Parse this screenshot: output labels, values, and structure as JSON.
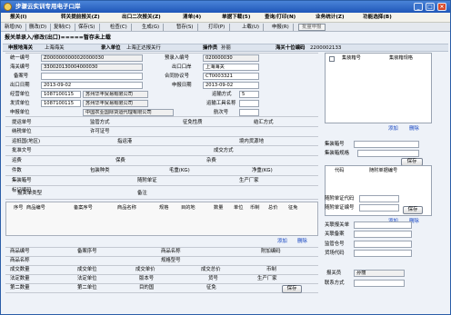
{
  "window": {
    "title": "步骤云实训专用电子口岸",
    "min": "_",
    "max": "□",
    "close": "×"
  },
  "menu": [
    {
      "id": "baoguan",
      "label": "报关(I)"
    },
    {
      "id": "zhuanguan",
      "label": "转关提前报关(Z)"
    },
    {
      "id": "chukou",
      "label": "出口二次报关(Z)"
    },
    {
      "id": "qingdan",
      "label": "清单(4)"
    },
    {
      "id": "download",
      "label": "单据下载(5)"
    },
    {
      "id": "query",
      "label": "查询/打印(N)"
    },
    {
      "id": "stats",
      "label": "业务统计(Z)"
    },
    {
      "id": "func",
      "label": "功能选择(B)"
    }
  ],
  "toolbar": [
    {
      "id": "new",
      "label": "新增(N)"
    },
    {
      "id": "delete",
      "label": "删改(D)"
    },
    {
      "id": "copy",
      "label": "复制(C)"
    },
    {
      "id": "save",
      "label": "保存(S)"
    },
    {
      "id": "check",
      "label": "检查(C)"
    },
    {
      "id": "generate",
      "label": "生成(G)"
    },
    {
      "id": "stage",
      "label": "暂存(S)"
    },
    {
      "id": "print",
      "label": "打印(P)"
    },
    {
      "id": "upload",
      "label": "上载(U)"
    },
    {
      "id": "declare",
      "label": "申报(R)"
    }
  ],
  "toolbar_batch": "批量申报",
  "page_heading": "报关单录入/修改(出口)=====暂存未上载",
  "header_row": {
    "station_label": "申报地海关",
    "station_value": "上海海关",
    "entry_label": "录入单位",
    "entry_value": "上海正达报关行",
    "operator_label": "操作员",
    "operator_value": "孙丽",
    "unified_label": "海关十位编码",
    "unified_value": "2200002133"
  },
  "form": {
    "tongyi_label": "统一编号",
    "tongyi_value": "Z0000000000020000030",
    "yulu_label": "预录入编号",
    "yulu_value": "020000030",
    "haiguan_label": "海关编号",
    "haiguan_value": "330020130004000030",
    "chukouan_label": "出口口岸",
    "chukouan_value": "上海海关",
    "beian_label": "备案号",
    "beian_value": "",
    "hetong_label": "合同协议号",
    "hetong_value": "CT0003321",
    "chukouriqi_label": "出口日期",
    "chukouriqi_value": "2013-09-02",
    "shenbaoriqi_label": "申报日期",
    "shenbaoriqi_value": "2013-09-02",
    "jingying_label": "经营单位",
    "jingying_code": "1087100115",
    "jingying_name": "苏州华丰贸易有限公司",
    "yunshufs_label": "运输方式",
    "yunshufs_value": "5",
    "fahuo_label": "发货单位",
    "fahuo_code": "1087100115",
    "fahuo_name": "苏州华丰贸易有限公司",
    "yunshugj_label": "运输工具名称",
    "yunshugj_value": "",
    "shenbaodw_label": "申报单位",
    "shenbaodw_value": "中国农业国际货运代理有限公司",
    "hangci_label": "航次号",
    "hangci_value": "",
    "tiyun_label": "提运单号",
    "jianguan_label": "监管方式",
    "zhengmian_label": "征免性质",
    "jiehui_label": "结汇方式",
    "nashui_label": "纳税单位",
    "xuke_label": "许可证号",
    "yundiguo_label": "运抵国(地区)",
    "zhiyun_label": "指运港",
    "jingnei_label": "境内货源地",
    "piwen_label": "批准文号",
    "chengjiao_label": "成交方式",
    "yunfei_label": "运费",
    "baofei_label": "保费",
    "zafei_label": "杂费",
    "jianshu_label": "件数",
    "baozhuang_label": "包装种类",
    "maozhong_label": "毛重(KG)",
    "jingzhong_label": "净重(KG)",
    "jizhuangxiang_label": "集装箱号",
    "suifu_label": "随附单证",
    "shengchan_label": "生产厂家",
    "biaoji_label": "标记唛码",
    "guanlian_label": "报关单类型",
    "beizhu_label": "备注"
  },
  "goods_headers": [
    "序号",
    "商品编号",
    "备案序号",
    "商品名称",
    "规格",
    "目的地",
    "数量",
    "单位",
    "币制",
    "总价",
    "征免"
  ],
  "goods_actions": {
    "add": "添加",
    "delete": "删除"
  },
  "detail": {
    "spbh_label": "商品编号",
    "baxh_label": "备案序号",
    "spmc_label": "商品名称",
    "fjbh_label": "附加编码",
    "spmc2_label": "商品名称",
    "ggxh_label": "规格型号",
    "cjsl_label": "成交数量",
    "cjdw_label": "成交单位",
    "cjdj_label": "成交单价",
    "cjzj_label": "成交总价",
    "bz_label": "币制",
    "fdsl_label": "法定数量",
    "fddw_label": "法定单位",
    "bbxh_label": "版本号",
    "hhh_label": "货号",
    "sccj_label": "生产厂家",
    "desl_label": "第二数量",
    "dedw_label": "第二单位",
    "mdg_label": "目的国",
    "zm_label": "征免",
    "save": "保存"
  },
  "right": {
    "container_col1": "集装箱号",
    "container_col2": "集装箱规格",
    "add": "添加",
    "delete": "删除",
    "container_no_label": "集装箱号",
    "container_spec_label": "集装箱规格",
    "save": "保存",
    "docs_col1": "代码",
    "docs_col2": "随附单据编号",
    "docs_add": "添加",
    "docs_delete": "删除",
    "lic_code_label": "随附单证代码",
    "lic_no_label": "随附单证编号",
    "lic_save": "保存",
    "relation_no_label": "关联报关单",
    "relation_record_label": "关联备案",
    "regulatory_label": "监管仓号",
    "yard_label": "货场代码",
    "declarer_label": "报关员",
    "declarer_value": "孙丽",
    "contact_label": "联系方式"
  },
  "colors": {
    "accent": "#1f56b8",
    "panel": "#eef2f8",
    "grid": "#c4c9d2",
    "link": "#1040c0"
  }
}
